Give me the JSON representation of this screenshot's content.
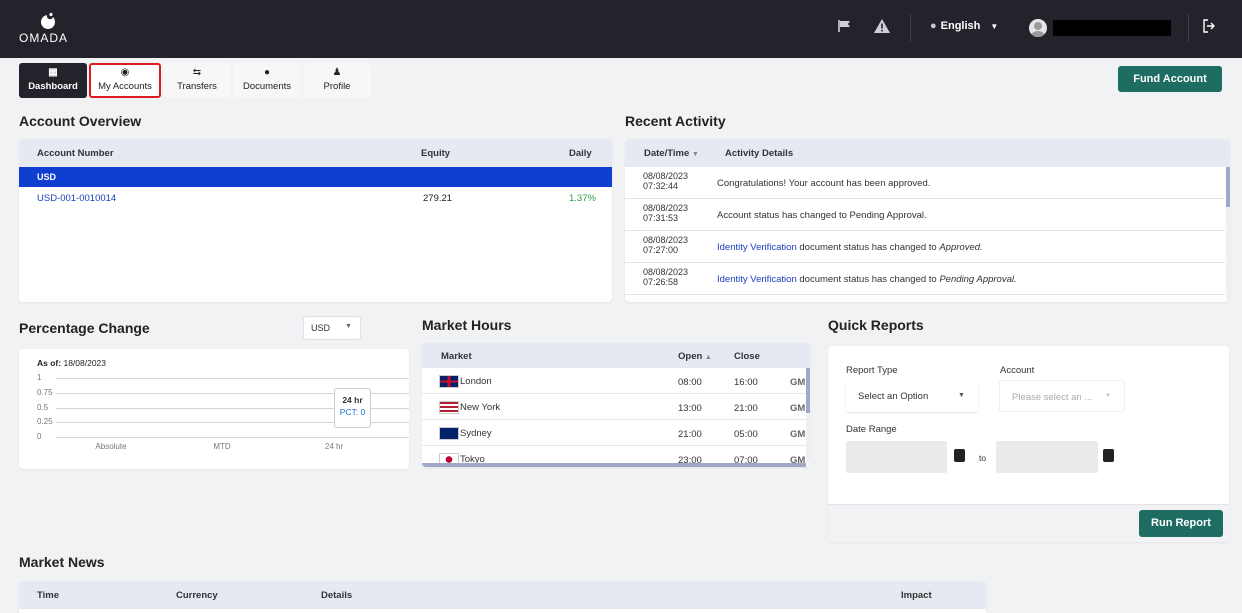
{
  "brand": {
    "logo_text": "OMADA"
  },
  "topbar": {
    "language": "English"
  },
  "nav": {
    "tabs": [
      {
        "label": "Dashboard"
      },
      {
        "label": "My Accounts"
      },
      {
        "label": "Transfers"
      },
      {
        "label": "Documents"
      },
      {
        "label": "Profile"
      }
    ],
    "fund_account": "Fund Account"
  },
  "account_overview": {
    "title": "Account Overview",
    "columns": [
      "Account Number",
      "Equity",
      "Daily"
    ],
    "group": "USD",
    "rows": [
      {
        "account": "USD-001-0010014",
        "equity": "279.21",
        "daily": "1.37%"
      }
    ]
  },
  "recent_activity": {
    "title": "Recent Activity",
    "columns": [
      "Date/Time",
      "Activity Details"
    ],
    "rows": [
      {
        "date": "08/08/2023",
        "time": "07:32:44",
        "link": "",
        "text": "Congratulations! Your account has been approved.",
        "status": ""
      },
      {
        "date": "08/08/2023",
        "time": "07:31:53",
        "link": "",
        "text": "Account status has changed to Pending Approval.",
        "status": ""
      },
      {
        "date": "08/08/2023",
        "time": "07:27:00",
        "link": "Identity Verification",
        "text": " document status has changed to ",
        "status": "Approved."
      },
      {
        "date": "08/08/2023",
        "time": "07:26:58",
        "link": "Identity Verification",
        "text": " document status has changed to ",
        "status": "Pending Approval."
      }
    ]
  },
  "percentage_change": {
    "title": "Percentage Change",
    "currency": "USD",
    "as_of_label": "As of:",
    "as_of_date": "18/08/2023",
    "tooltip_title": "24 hr",
    "tooltip_value": "PCT: 0"
  },
  "chart_data": {
    "type": "bar",
    "categories": [
      "Absolute",
      "MTD",
      "24 hr"
    ],
    "series": [
      {
        "values": [
          0,
          0,
          0
        ]
      }
    ],
    "yticks": [
      "1",
      "0.75",
      "0.5",
      "0.25",
      "0"
    ],
    "ylim": [
      0,
      1
    ],
    "grid": true
  },
  "market_hours": {
    "title": "Market Hours",
    "columns": [
      "Market",
      "Open",
      "Close"
    ],
    "rows": [
      {
        "market": "London",
        "open": "08:00",
        "close": "16:00",
        "tz": "GM"
      },
      {
        "market": "New York",
        "open": "13:00",
        "close": "21:00",
        "tz": "GM"
      },
      {
        "market": "Sydney",
        "open": "21:00",
        "close": "05:00",
        "tz": "GM"
      },
      {
        "market": "Tokyo",
        "open": "23:00",
        "close": "07:00",
        "tz": "GM"
      }
    ]
  },
  "quick_reports": {
    "title": "Quick Reports",
    "report_type_label": "Report Type",
    "report_type_value": "Select an Option",
    "account_label": "Account",
    "account_placeholder": "Please select an ...",
    "date_range_label": "Date Range",
    "to_label": "to",
    "run_report": "Run Report"
  },
  "market_news": {
    "title": "Market News",
    "columns": [
      "Time",
      "Currency",
      "Details",
      "Impact"
    ]
  }
}
